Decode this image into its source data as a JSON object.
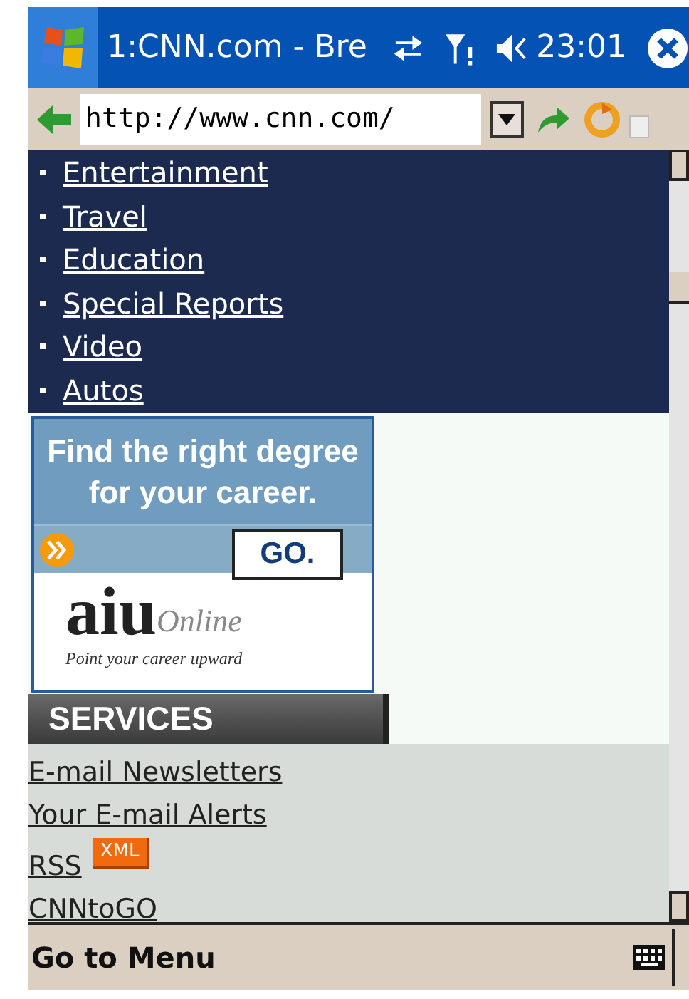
{
  "title_bar": {
    "title": "1:CNN.com - Bre",
    "time": "23:01"
  },
  "address_bar": {
    "url": "http://www.cnn.com/"
  },
  "nav_links": [
    {
      "label": "Entertainment"
    },
    {
      "label": "Travel"
    },
    {
      "label": "Education"
    },
    {
      "label": "Special Reports"
    },
    {
      "label": "Video"
    },
    {
      "label": "Autos"
    }
  ],
  "ad": {
    "headline": "Find the right degree for your career.",
    "button": "GO.",
    "logo": "aiu",
    "logo_suffix": "Online",
    "tagline": "Point your career upward"
  },
  "services": {
    "heading": "SERVICES",
    "links": [
      {
        "label": "E-mail Newsletters"
      },
      {
        "label": "Your E-mail Alerts"
      },
      {
        "label": "RSS",
        "badge": "XML"
      },
      {
        "label": "CNNtoGO"
      }
    ]
  },
  "menu_bar": {
    "left": "Go to Menu"
  }
}
